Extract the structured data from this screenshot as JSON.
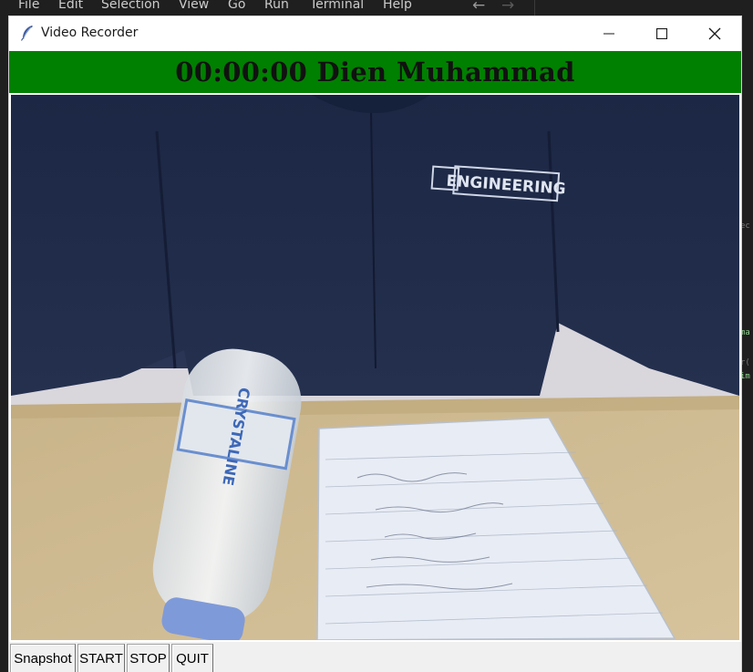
{
  "editor": {
    "menu": [
      "File",
      "Edit",
      "Selection",
      "View",
      "Go",
      "Run",
      "Terminal",
      "Help"
    ],
    "back_arrow": "←",
    "forward_arrow": "→",
    "code_fragments": [
      "ec",
      "ma",
      "r(",
      "im"
    ]
  },
  "window": {
    "title": "Video Recorder",
    "icon": "feather-icon",
    "controls": [
      "minimize-icon",
      "maximize-icon",
      "close-icon"
    ]
  },
  "header": {
    "text": "00:00:00 Dien Muhammad",
    "background": "#008000"
  },
  "video": {
    "shirt_logo_text": "ENGINEERING",
    "bottle_label": "CRYSTALINE"
  },
  "buttons": {
    "snapshot": "Snapshot",
    "start": "START",
    "stop": "STOP",
    "quit": "QUIT"
  }
}
